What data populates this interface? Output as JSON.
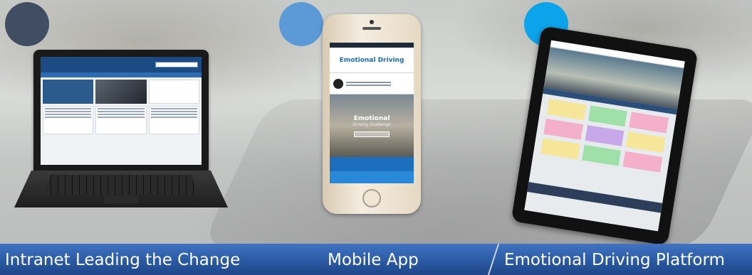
{
  "colors": {
    "dot_1": "#414d63",
    "dot_2": "#5b9ad6",
    "dot_3": "#0ba4ea",
    "bar_top": "#3f73c2",
    "bar_bottom": "#1f4688"
  },
  "labels": {
    "intranet": "Intranet Leading the Change",
    "mobile": "Mobile App",
    "platform": "Emotional Driving Platform"
  },
  "phone": {
    "header_title": "Emotional Driving",
    "hero_title": "Emotional",
    "hero_subtitle": "Driving Challenge"
  },
  "tablet": {
    "note_colors": [
      "#f5e69a",
      "#9fe0a8",
      "#f4b0c8",
      "#f4b0c8",
      "#c8a8e8",
      "#f5e69a",
      "#f5e69a",
      "#9fe0a8",
      "#f4b0c8"
    ]
  }
}
